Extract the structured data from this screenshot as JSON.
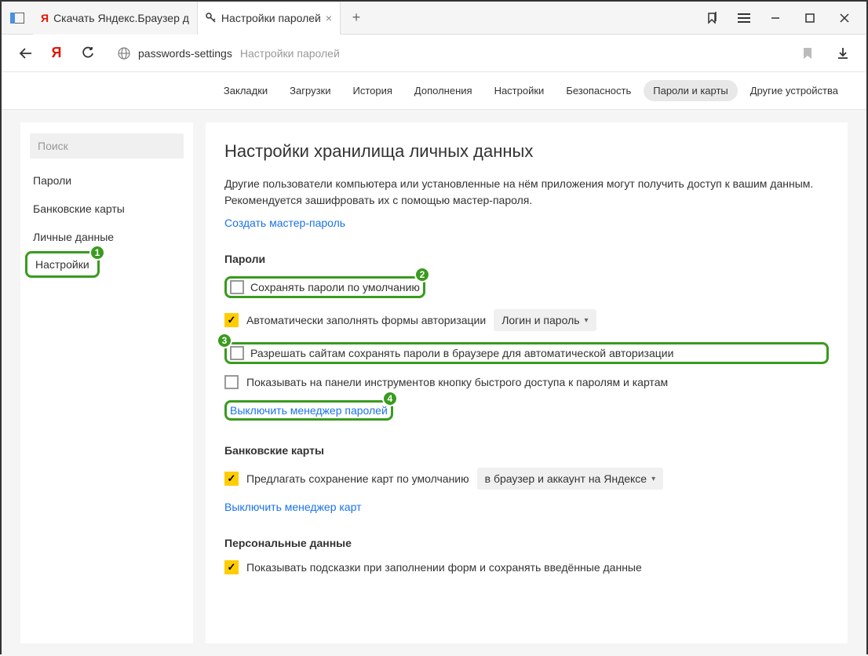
{
  "titlebar": {
    "tabs": [
      {
        "title": "Скачать Яндекс.Браузер д",
        "icon_color": "#e61400"
      },
      {
        "title": "Настройки паролей",
        "icon": "key"
      }
    ]
  },
  "toolbar": {
    "url": "passwords-settings",
    "title": "Настройки паролей"
  },
  "topnav": {
    "items": [
      {
        "label": "Закладки"
      },
      {
        "label": "Загрузки"
      },
      {
        "label": "История"
      },
      {
        "label": "Дополнения"
      },
      {
        "label": "Настройки"
      },
      {
        "label": "Безопасность"
      },
      {
        "label": "Пароли и карты",
        "active": true
      },
      {
        "label": "Другие устройства"
      }
    ]
  },
  "sidebar": {
    "search_placeholder": "Поиск",
    "items": [
      {
        "label": "Пароли"
      },
      {
        "label": "Банковские карты"
      },
      {
        "label": "Личные данные"
      },
      {
        "label": "Настройки",
        "active": true,
        "badge": "1"
      }
    ]
  },
  "main": {
    "heading": "Настройки хранилища личных данных",
    "description": "Другие пользователи компьютера или установленные на нём приложения могут получить доступ к вашим данным. Рекомендуется зашифровать их с помощью мастер-пароля.",
    "create_master_link": "Создать мастер-пароль",
    "sections": {
      "passwords": {
        "title": "Пароли",
        "rows": [
          {
            "label": "Сохранять пароли по умолчанию",
            "checked": false,
            "badge": "2",
            "highlight": true
          },
          {
            "label": "Автоматически заполнять формы авторизации",
            "checked": true,
            "dropdown": "Логин и пароль"
          },
          {
            "label": "Разрешать сайтам сохранять пароли в браузере для автоматической авторизации",
            "checked": false,
            "badge": "3",
            "highlight": true
          },
          {
            "label": "Показывать на панели инструментов кнопку быстрого доступа к паролям и картам",
            "checked": false
          }
        ],
        "disable_link": "Выключить менеджер паролей",
        "disable_badge": "4"
      },
      "cards": {
        "title": "Банковские карты",
        "rows": [
          {
            "label": "Предлагать сохранение карт по умолчанию",
            "checked": true,
            "dropdown": "в браузер и аккаунт на Яндексе"
          }
        ],
        "disable_link": "Выключить менеджер карт"
      },
      "personal": {
        "title": "Персональные данные",
        "rows": [
          {
            "label": "Показывать подсказки при заполнении форм и сохранять введённые данные",
            "checked": true
          }
        ]
      }
    }
  }
}
